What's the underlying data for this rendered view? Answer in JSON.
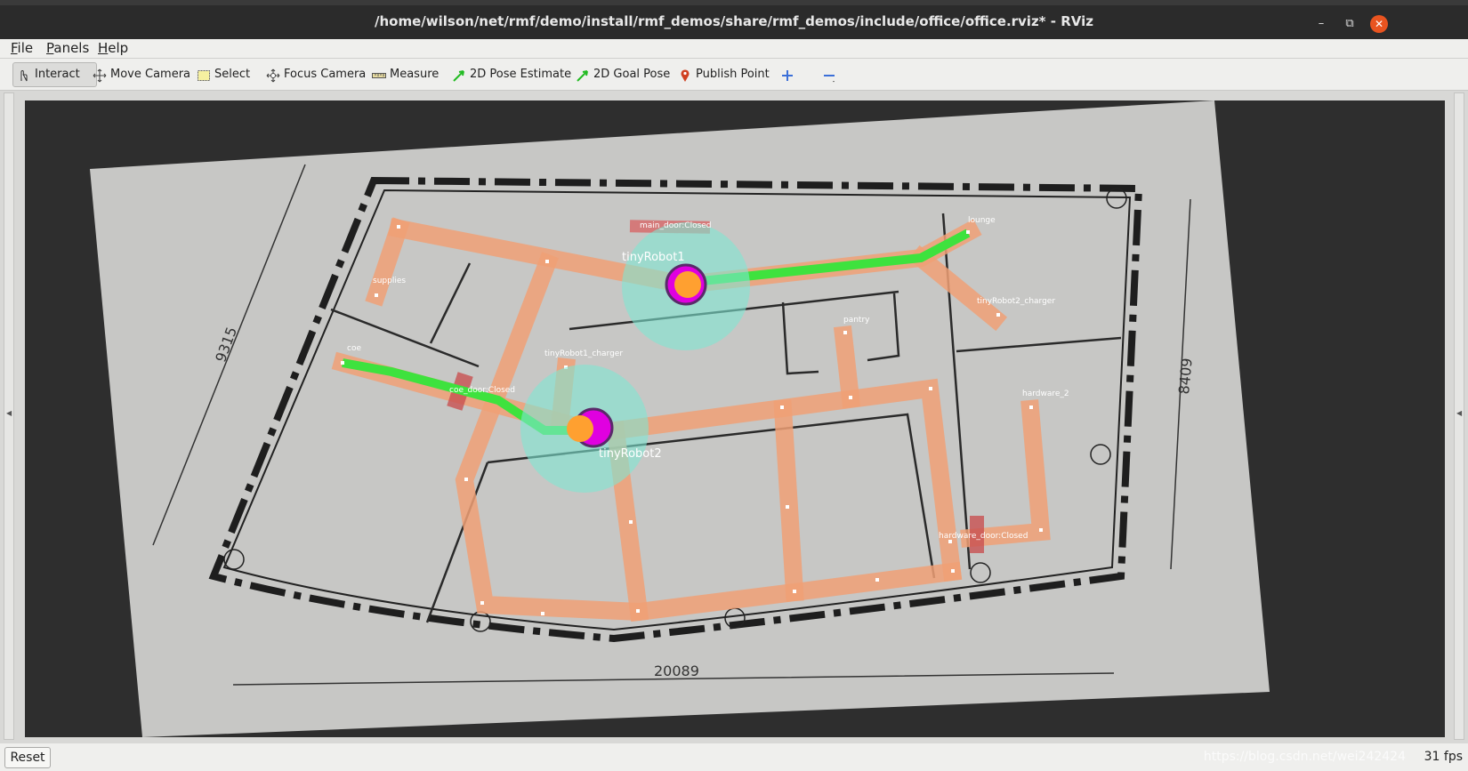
{
  "window": {
    "title": "/home/wilson/net/rmf/demo/install/rmf_demos/share/rmf_demos/include/office/office.rviz* - RViz",
    "minimize_glyph": "–",
    "restore_glyph": "⧉",
    "close_glyph": "✕"
  },
  "menu": {
    "file": "File",
    "panels": "Panels",
    "help": "Help"
  },
  "toolbar": {
    "interact": "Interact",
    "move_camera": "Move Camera",
    "select": "Select",
    "focus_camera": "Focus Camera",
    "measure": "Measure",
    "pose_estimate": "2D Pose Estimate",
    "goal_pose": "2D Goal Pose",
    "publish_point": "Publish Point"
  },
  "map": {
    "robots": {
      "robot1": "tinyRobot1",
      "robot2": "tinyRobot2"
    },
    "waypoints": {
      "supplies": "supplies",
      "coe": "coe",
      "pantry": "pantry",
      "lounge": "lounge",
      "robot1_charger": "tinyRobot1_charger",
      "robot2_charger": "tinyRobot2_charger",
      "hardware_2": "hardware_2"
    },
    "doors": {
      "main_door": "main_door:Closed",
      "coe_door": "coe_door:Closed",
      "hardware_door": "hardware_door:Closed"
    },
    "dimensions": {
      "left": "9315",
      "right": "8409",
      "bottom": "20089"
    }
  },
  "status": {
    "reset": "Reset",
    "fps": "31 fps",
    "watermark": "https://blog.csdn.net/wei242424"
  },
  "colors": {
    "lane": "#f0a075",
    "path": "#3ee23e",
    "robot": "#e000e0",
    "footprint": "#7fe6d2",
    "accent": "#e95420"
  }
}
